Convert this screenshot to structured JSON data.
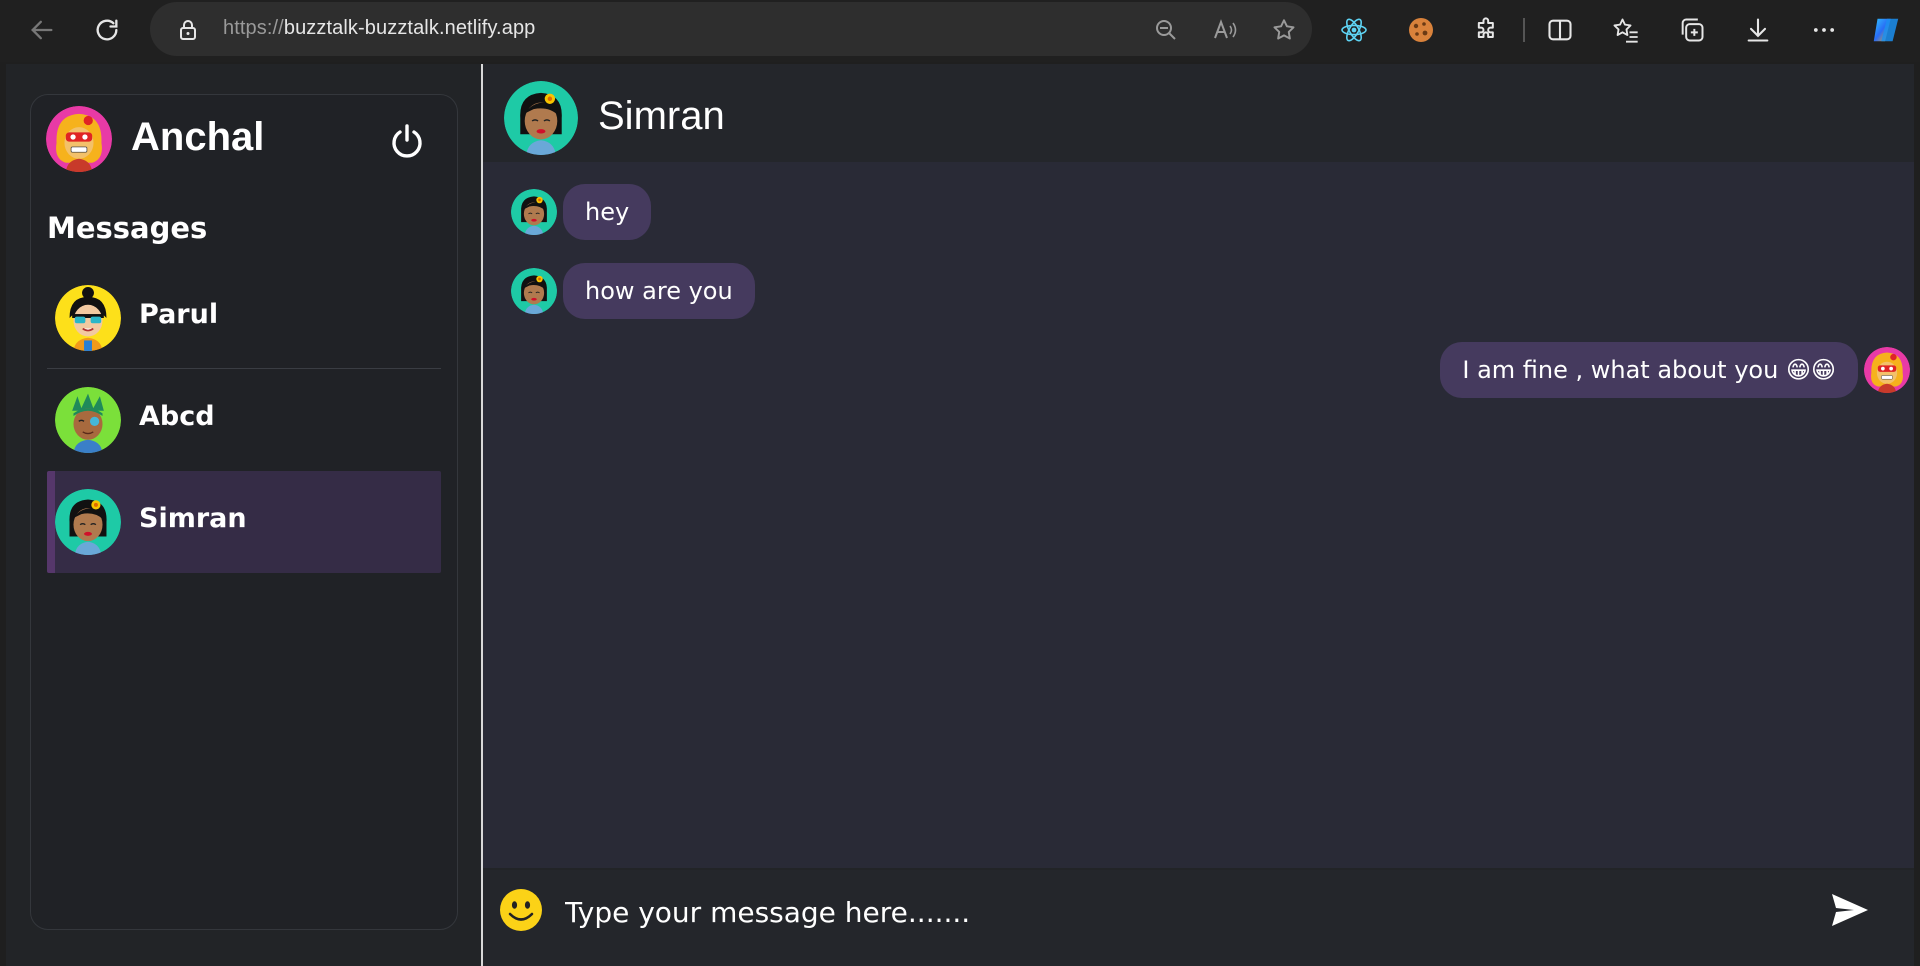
{
  "browser": {
    "url_scheme": "https://",
    "url_host": "buzztalk-buzztalk.netlify.app"
  },
  "sidebar": {
    "current_user": "Anchal",
    "heading": "Messages",
    "contacts": [
      {
        "name": "Parul",
        "avatar": "parul-avatar",
        "active": false
      },
      {
        "name": "Abcd",
        "avatar": "abcd-avatar",
        "active": false
      },
      {
        "name": "Simran",
        "avatar": "simran-avatar",
        "active": true
      }
    ]
  },
  "chat": {
    "title": "Simran",
    "messages": [
      {
        "from": "Simran",
        "direction": "in",
        "text": "hey"
      },
      {
        "from": "Simran",
        "direction": "in",
        "text": "how are you"
      },
      {
        "from": "Anchal",
        "direction": "out",
        "text": "I am fine , what about you 😁😁"
      }
    ],
    "composer": {
      "placeholder": "Type your message here.......",
      "emoji_icon": "smiley-icon",
      "send_icon": "send-icon"
    }
  },
  "colors": {
    "accent": "#453a5e",
    "active_contact": "#352c46",
    "background": "#292a36"
  }
}
